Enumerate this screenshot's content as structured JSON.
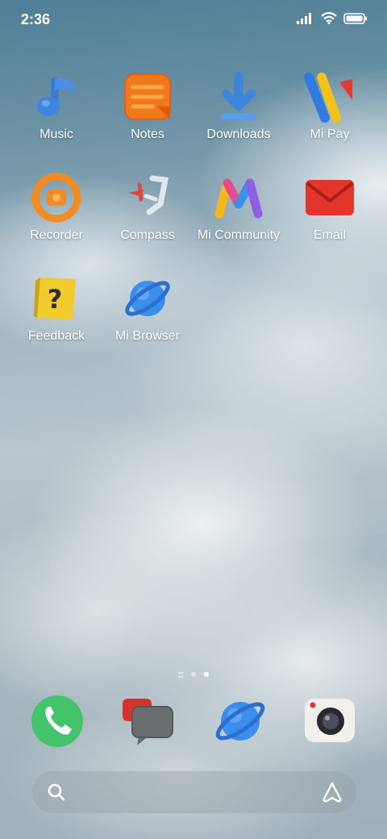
{
  "status_bar": {
    "time": "2:36",
    "icons": [
      "signal-icon",
      "wifi-icon",
      "battery-icon"
    ]
  },
  "apps": [
    {
      "label": "Music",
      "icon": "music-icon"
    },
    {
      "label": "Notes",
      "icon": "notes-icon"
    },
    {
      "label": "Downloads",
      "icon": "downloads-icon"
    },
    {
      "label": "Mi Pay",
      "icon": "mi-pay-icon"
    },
    {
      "label": "Recorder",
      "icon": "recorder-icon"
    },
    {
      "label": "Compass",
      "icon": "compass-icon"
    },
    {
      "label": "Mi Community",
      "icon": "mi-community-icon"
    },
    {
      "label": "Email",
      "icon": "email-icon"
    },
    {
      "label": "Feedback",
      "icon": "feedback-icon"
    },
    {
      "label": "Mi Browser",
      "icon": "mi-browser-icon"
    }
  ],
  "page_indicator": {
    "pages": 2,
    "active_page": 2
  },
  "dock": [
    {
      "icon": "phone-icon"
    },
    {
      "icon": "messaging-icon"
    },
    {
      "icon": "browser-icon"
    },
    {
      "icon": "camera-icon"
    }
  ],
  "search_bar": {
    "search_icon": "search-icon",
    "assistant_icon": "assistant-icon"
  },
  "colors": {
    "wallpaper_sky": "#5c8aa1",
    "clouds": "#e8edf0",
    "label_text": "#ffffff"
  }
}
